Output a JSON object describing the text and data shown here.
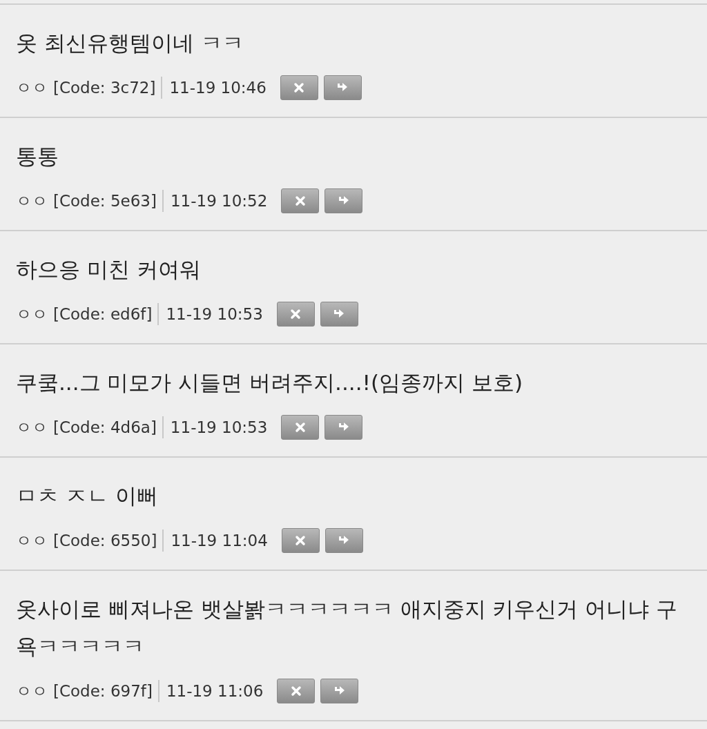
{
  "comments": [
    {
      "text": "옷 최신유행템이네 ㅋㅋ",
      "author": "ㅇㅇ",
      "code": "[Code: 3c72]",
      "time": "11-19 10:46"
    },
    {
      "text": "통통",
      "author": "ㅇㅇ",
      "code": "[Code: 5e63]",
      "time": "11-19 10:52"
    },
    {
      "text": "하으응 미친 커여워",
      "author": "ㅇㅇ",
      "code": "[Code: ed6f]",
      "time": "11-19 10:53"
    },
    {
      "text": "쿠쿸...그 미모가 시들면 버려주지....!(임종까지 보호)",
      "author": "ㅇㅇ",
      "code": "[Code: 4d6a]",
      "time": "11-19 10:53"
    },
    {
      "text": "ㅁㅊ ㅈㄴ 이뻐",
      "author": "ㅇㅇ",
      "code": "[Code: 6550]",
      "time": "11-19 11:04"
    },
    {
      "text": "옷사이로 삐져나온 뱃살봙ㅋㅋㅋㅋㅋㅋ 애지중지 키우신거 어니냐 구욕ㅋㅋㅋㅋㅋ",
      "author": "ㅇㅇ",
      "code": "[Code: 697f]",
      "time": "11-19 11:06"
    }
  ]
}
